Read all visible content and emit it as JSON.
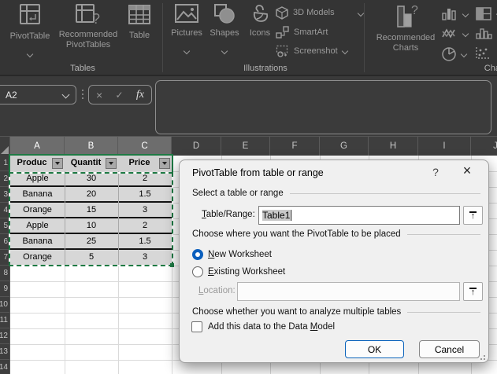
{
  "ribbon": {
    "tables": {
      "group_label": "Tables",
      "pivottable": "PivotTable",
      "recommended_line1": "Recommended",
      "recommended_line2": "PivotTables",
      "table": "Table"
    },
    "illustrations": {
      "group_label": "Illustrations",
      "pictures": "Pictures",
      "shapes": "Shapes",
      "icons": "Icons",
      "models3d": "3D Models",
      "smartart": "SmartArt",
      "screenshot": "Screenshot"
    },
    "charts": {
      "group_label": "Charts",
      "recommended_line1": "Recommended",
      "recommended_line2": "Charts"
    }
  },
  "formula_bar": {
    "name_box_value": "A2",
    "cancel_glyph": "×",
    "enter_glyph": "✓",
    "fx_glyph": "fx",
    "formula_value": ""
  },
  "grid": {
    "column_letters": [
      "A",
      "B",
      "C",
      "D",
      "E",
      "F",
      "G",
      "H",
      "I",
      "J"
    ],
    "row_numbers": [
      "1",
      "2",
      "3",
      "4",
      "5",
      "6",
      "7",
      "8",
      "9",
      "10",
      "11",
      "12",
      "13",
      "14"
    ],
    "table": {
      "headers": [
        "Produc",
        "Quantit",
        "Price"
      ],
      "rows": [
        [
          "Apple",
          "30",
          "2"
        ],
        [
          "Banana",
          "20",
          "1.5"
        ],
        [
          "Orange",
          "15",
          "3"
        ],
        [
          "Apple",
          "10",
          "2"
        ],
        [
          "Banana",
          "25",
          "1.5"
        ],
        [
          "Orange",
          "5",
          "3"
        ]
      ]
    }
  },
  "dialog": {
    "title": "PivotTable from table or range",
    "help_glyph": "?",
    "close_glyph": "×",
    "section_select": "Select a table or range",
    "table_range_key": "T",
    "table_range_rest": "able/Range:",
    "table_range_value": "Table1",
    "section_where": "Choose where you want the PivotTable to be placed",
    "new_ws_key": "N",
    "new_ws_rest": "ew Worksheet",
    "existing_ws_key": "E",
    "existing_ws_rest": "xisting Worksheet",
    "location_key": "L",
    "location_rest": "ocation:",
    "location_value": "",
    "section_multi": "Choose whether you want to analyze multiple tables",
    "data_model_pre": "Add this data to the Data ",
    "data_model_key": "M",
    "data_model_rest": "odel",
    "ok_label": "OK",
    "cancel_label": "Cancel"
  },
  "colors": {
    "accent_blue": "#0b5fbd",
    "excel_green": "#1e7a44",
    "ribbon_bg": "#343434",
    "selection_fill": "#d7d7d7"
  }
}
